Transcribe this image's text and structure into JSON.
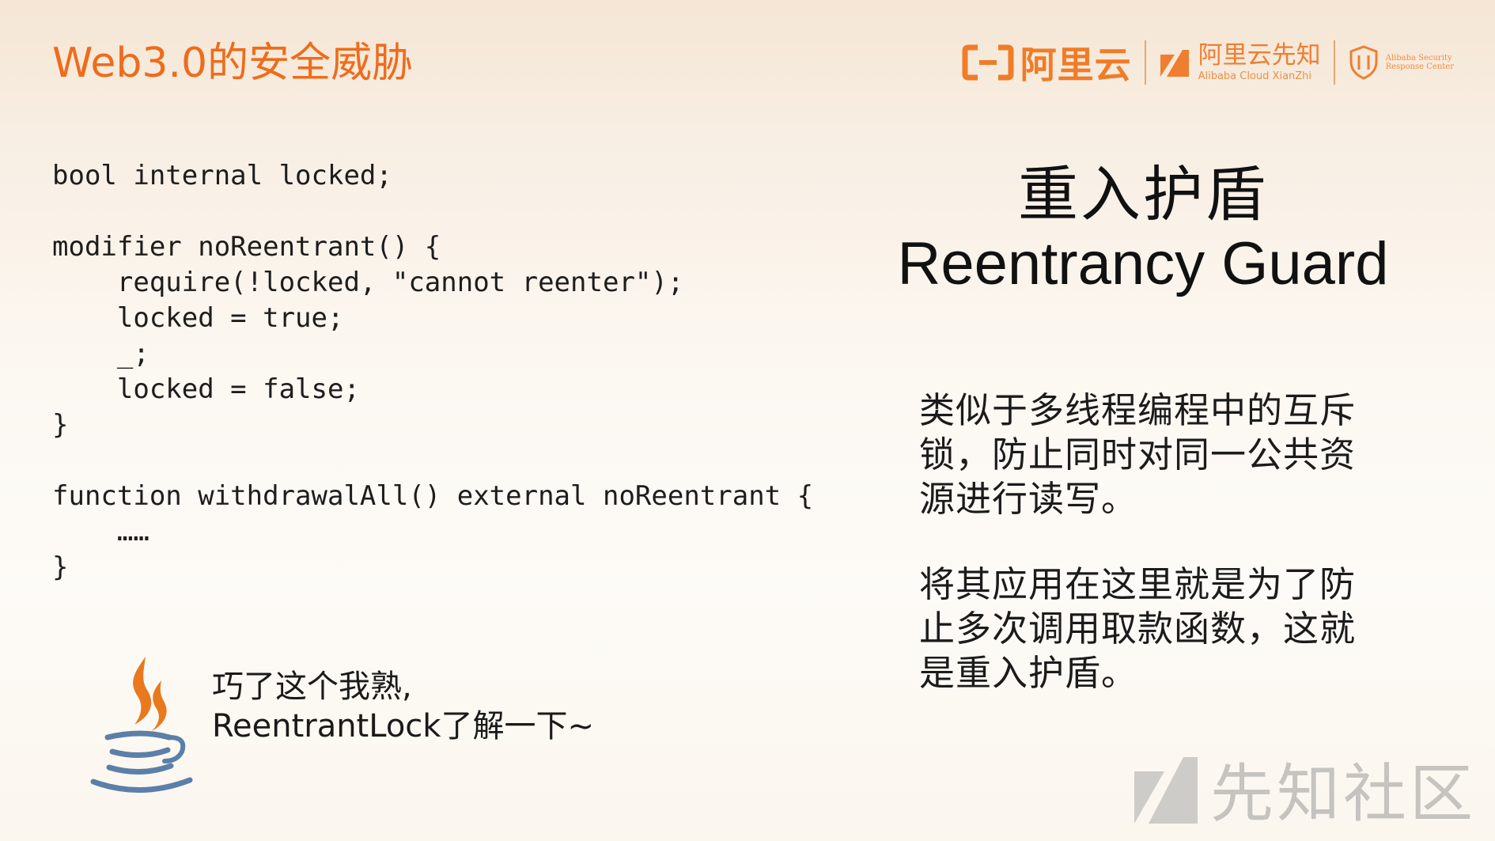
{
  "slide": {
    "title": "Web3.0的安全威胁"
  },
  "header_logos": {
    "aliyun_name": "阿里云",
    "xianzhi_name": "阿里云先知",
    "xianzhi_en": "Alibaba Cloud XianZhi",
    "asrc_line1": "Alibaba Security",
    "asrc_line2": "Response Center"
  },
  "code": {
    "lines": [
      "bool internal locked;",
      "",
      "modifier noReentrant() {",
      "    require(!locked, \"cannot reenter\");",
      "    locked = true;",
      "    _;",
      "    locked = false;",
      "}",
      "",
      "function withdrawalAll() external noReentrant {",
      "    ……",
      "}"
    ]
  },
  "guard": {
    "title_cn": "重入护盾",
    "title_en": "Reentrancy Guard"
  },
  "description": {
    "para1": "类似于多线程编程中的互斥锁，防止同时对同一公共资源进行读写。",
    "para2": "将其应用在这里就是为了防止多次调用取款函数，这就是重入护盾。"
  },
  "note": {
    "line1": "巧了这个我熟,",
    "line2": "ReentrantLock了解一下~"
  },
  "watermark": {
    "text": "先知社区"
  },
  "colors": {
    "title": "#ee6c1c",
    "brand_orange": "#f07c28",
    "java_flame": "#e8791f",
    "java_cup": "#5b7fa8"
  }
}
